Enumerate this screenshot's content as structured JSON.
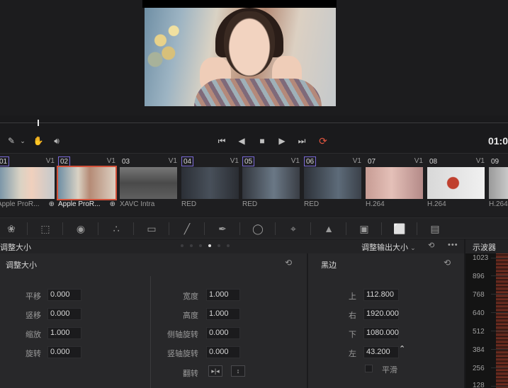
{
  "transport": {
    "timecode": "01:0"
  },
  "clips": [
    {
      "num": "01",
      "track": "V1",
      "codec": "Apple ProR...",
      "num_color": "#7a6ad8"
    },
    {
      "num": "02",
      "track": "V1",
      "codec": "Apple ProR...",
      "num_color": "#7a6ad8"
    },
    {
      "num": "03",
      "track": "V1",
      "codec": "XAVC Intra",
      "num_color": ""
    },
    {
      "num": "04",
      "track": "V1",
      "codec": "RED",
      "num_color": "#7a6ad8"
    },
    {
      "num": "05",
      "track": "V1",
      "codec": "RED",
      "num_color": "#7a6ad8"
    },
    {
      "num": "06",
      "track": "V1",
      "codec": "RED",
      "num_color": "#7a6ad8"
    },
    {
      "num": "07",
      "track": "V1",
      "codec": "H.264",
      "num_color": ""
    },
    {
      "num": "08",
      "track": "V1",
      "codec": "H.264",
      "num_color": ""
    },
    {
      "num": "09",
      "track": "",
      "codec": "H.264",
      "num_color": ""
    }
  ],
  "panel": {
    "title": "调整大小",
    "mode_label": "调整输出大小",
    "scope_title": "示波器"
  },
  "resize": {
    "title": "调整大小",
    "pan_label": "平移",
    "pan_value": "0.000",
    "tilt_label": "竖移",
    "tilt_value": "0.000",
    "zoom_label": "缩放",
    "zoom_value": "1.000",
    "rotate_label": "旋转",
    "rotate_value": "0.000",
    "width_label": "宽度",
    "width_value": "1.000",
    "height_label": "高度",
    "height_value": "1.000",
    "pitch_label": "侧轴旋转",
    "pitch_value": "0.000",
    "yaw_label": "竖轴旋转",
    "yaw_value": "0.000",
    "flip_label": "翻转"
  },
  "blanking": {
    "title": "黑边",
    "top_label": "上",
    "top_value": "112.800",
    "right_label": "右",
    "right_value": "1920.000",
    "bottom_label": "下",
    "bottom_value": "1080.000",
    "left_label": "左",
    "left_value": "43.200",
    "smooth_label": "平滑"
  },
  "scope": {
    "ticks": [
      "1023",
      "896",
      "768",
      "640",
      "512",
      "384",
      "256",
      "128"
    ]
  },
  "colors": {
    "accent_red": "#d2513a",
    "loop_red": "#e0553f"
  }
}
